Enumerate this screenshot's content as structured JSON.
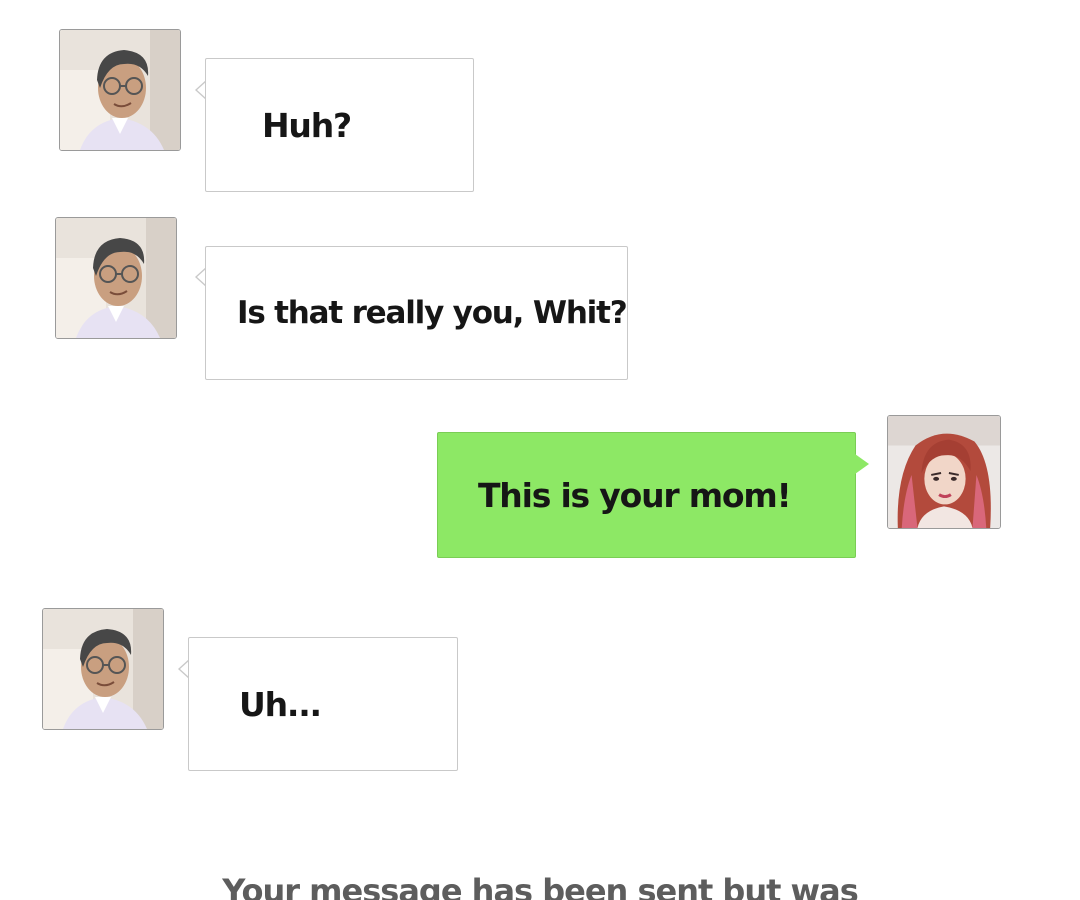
{
  "chat": {
    "messages": [
      {
        "sender": "dad",
        "side": "left",
        "text": "Huh?"
      },
      {
        "sender": "dad",
        "side": "left",
        "text": "Is that really you, Whit?"
      },
      {
        "sender": "mom",
        "side": "right",
        "text": "This is your mom!"
      },
      {
        "sender": "dad",
        "side": "left",
        "text": "Uh..."
      }
    ],
    "system_note": "Your message has been sent but was"
  },
  "colors": {
    "incoming_bubble": "#ffffff",
    "outgoing_bubble": "#8de865",
    "bubble_border": "#c9c9c9",
    "text": "#161616",
    "system_text": "#5d5d5d"
  },
  "icons": {
    "dad_avatar": "man-with-glasses-avatar-icon",
    "mom_avatar": "red-haired-woman-avatar-icon"
  }
}
